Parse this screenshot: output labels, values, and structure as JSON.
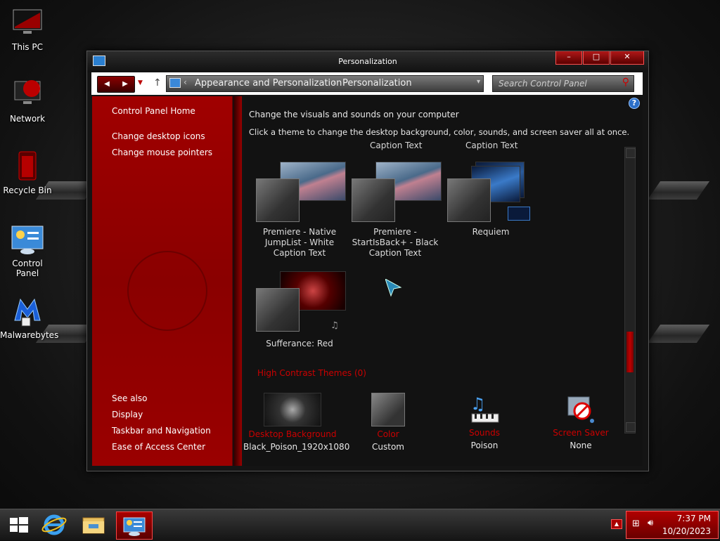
{
  "desktop": {
    "icons": [
      {
        "label": "This PC"
      },
      {
        "label": "Network"
      },
      {
        "label": "Recycle Bin"
      },
      {
        "label": "Control Panel"
      },
      {
        "label": "Malwarebytes"
      }
    ]
  },
  "window": {
    "title": "Personalization",
    "caption_buttons": {
      "minimize": "–",
      "maximize": "□",
      "close": "✕"
    },
    "address": {
      "crumb1": "Appearance and Personalization",
      "crumb2": "Personalization",
      "search_placeholder": "Search Control Panel"
    },
    "left_pane": {
      "links": [
        "Control Panel Home",
        "Change desktop icons",
        "Change mouse pointers"
      ],
      "see_also_title": "See also",
      "see_also": [
        "Display",
        "Taskbar and Navigation",
        "Ease of Access Center"
      ]
    },
    "main": {
      "heading": "Change the visuals and sounds on your computer",
      "description": "Click a theme to change the desktop background, color, sounds, and screen saver all at once.",
      "ghost_labels": [
        "Caption Text",
        "Caption Text"
      ],
      "themes": [
        {
          "name": "Premiere - Native JumpList - White Caption Text"
        },
        {
          "name": "Premiere - StartIsBack+ - Black Caption Text"
        },
        {
          "name": "Requiem"
        },
        {
          "name": "Sufferance: Red"
        }
      ],
      "high_contrast": "High Contrast Themes (0)",
      "bottom": [
        {
          "label": "Desktop Background",
          "value": "Black_Poison_1920x1080"
        },
        {
          "label": "Color",
          "value": "Custom"
        },
        {
          "label": "Sounds",
          "value": "Poison"
        },
        {
          "label": "Screen Saver",
          "value": "None"
        }
      ]
    }
  },
  "taskbar": {
    "time": "7:37 PM",
    "date": "10/20/2023"
  },
  "colors": {
    "accent": "#a00000",
    "bg": "#121212"
  }
}
